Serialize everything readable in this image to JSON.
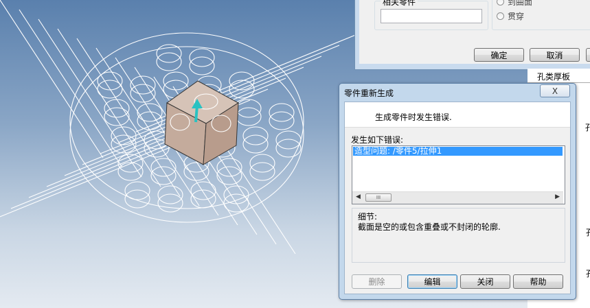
{
  "top_dialog": {
    "group_title": "相关零件",
    "radio_1": "到曲面",
    "radio_2": "贯穿",
    "ok_label": "确定",
    "cancel_label": "取消",
    "apply_label": "应用"
  },
  "side_panel": {
    "title": "孔类厚板",
    "fragment_1": "孔",
    "fragment_2": "孔",
    "fragment_3": "孔"
  },
  "error_dialog": {
    "title": "零件重新生成",
    "close_label": "X",
    "message": "生成零件时发生错误.",
    "occurred_label": "发生如下错误:",
    "errors": [
      "造型问题: /零件5/拉伸1"
    ],
    "scroll_thumb": "III",
    "detail_label": "细节:",
    "detail_text": "截面是空的或包含重叠或不封闭的轮廓.",
    "buttons": {
      "delete": "删除",
      "edit": "编辑",
      "close": "关闭",
      "help": "帮助"
    }
  },
  "colors": {
    "selection": "#3399ff",
    "cube_fill": "#c4ab9c",
    "arrow": "#29c2c2"
  }
}
